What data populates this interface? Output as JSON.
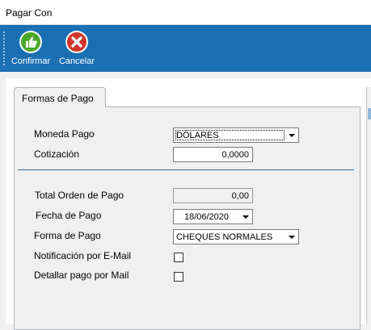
{
  "window": {
    "title": "Pagar Con"
  },
  "toolbar": {
    "confirm_label": "Confirmar",
    "cancel_label": "Cancelar",
    "confirm_color": "#4aa82a",
    "cancel_color": "#d2352a",
    "background": "#1b6fb3"
  },
  "tabs": [
    {
      "label": "Formas de Pago",
      "active": true
    }
  ],
  "currency": {
    "moneda_label": "Moneda Pago",
    "moneda_value": "DÓLARES",
    "cotizacion_label": "Cotización",
    "cotizacion_value": "0,0000"
  },
  "payment": {
    "total_label": "Total Orden de Pago",
    "total_value": "0,00",
    "fecha_label": "Fecha de Pago",
    "fecha_value": "18/06/2020",
    "forma_label": "Forma de Pago",
    "forma_value": "CHEQUES NORMALES",
    "notif_label": "Notificación por E-Mail",
    "notif_checked": false,
    "detalle_label": "Detallar pago por Mail",
    "detalle_checked": false
  }
}
